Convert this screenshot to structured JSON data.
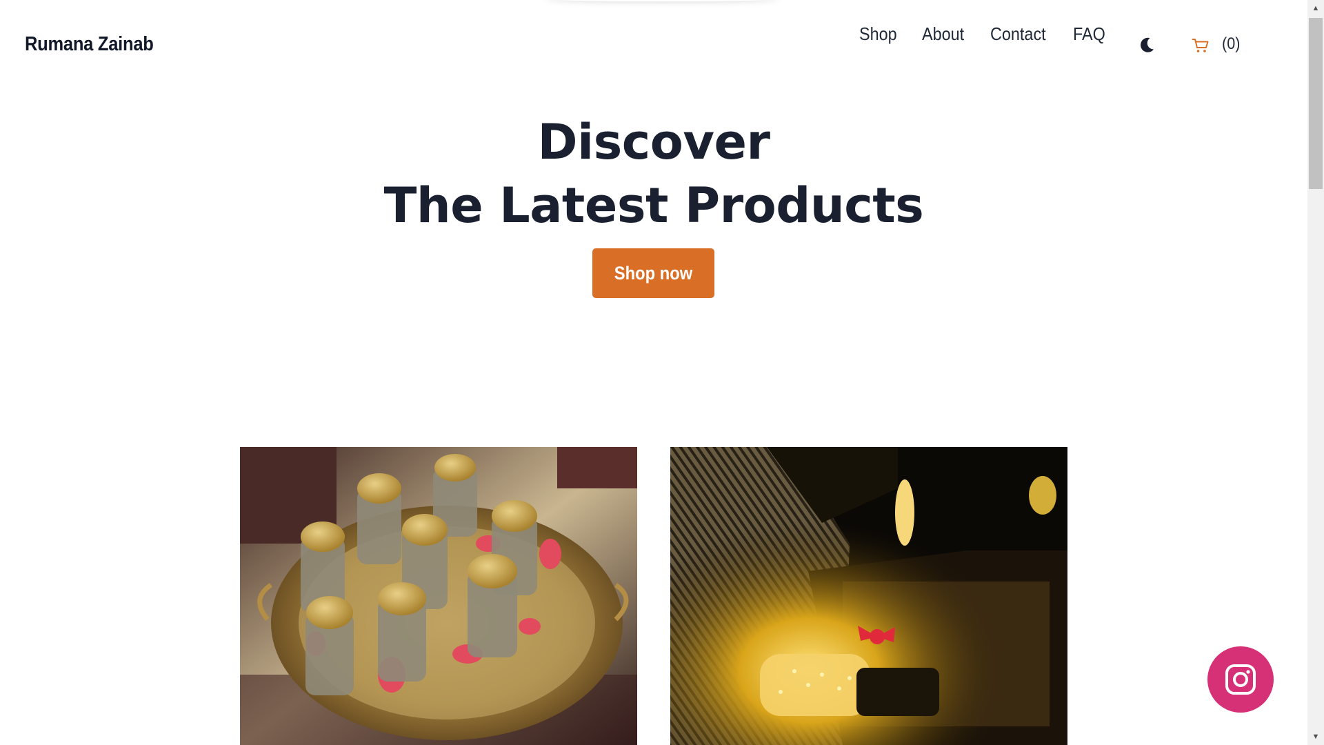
{
  "brand": {
    "name": "Rumana Zainab"
  },
  "nav": {
    "items": [
      {
        "label": "Shop"
      },
      {
        "label": "About"
      },
      {
        "label": "Contact"
      },
      {
        "label": "FAQ"
      }
    ],
    "theme_icon": "moon-icon",
    "cart_icon": "cart-icon",
    "cart_count": "(0)"
  },
  "hero": {
    "line1": "Discover",
    "line2": "The Latest Products",
    "cta_label": "Shop now"
  },
  "products": [
    {
      "image": "jars-on-gold-tray-photo"
    },
    {
      "image": "gift-box-with-lights-photo"
    }
  ],
  "social": {
    "icon": "instagram-icon"
  },
  "colors": {
    "accent": "#d96f27",
    "heading": "#1a2030",
    "instagram": "#d63177"
  }
}
